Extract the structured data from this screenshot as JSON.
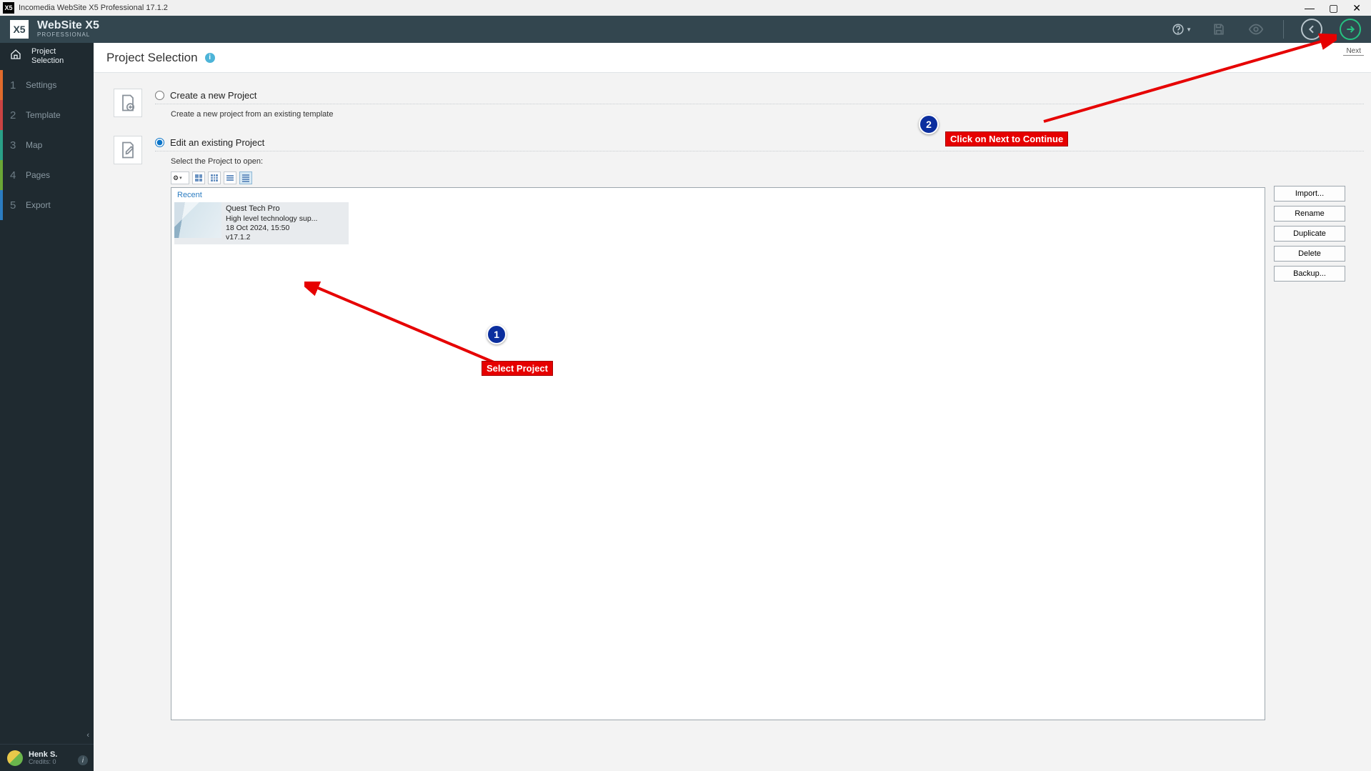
{
  "window": {
    "title": "Incomedia WebSite X5 Professional 17.1.2"
  },
  "brand": {
    "name": "WebSite X5",
    "edition": "PROFESSIONAL",
    "logo_text": "X5"
  },
  "header_buttons": {
    "next_label": "Next"
  },
  "sidebar": {
    "main": {
      "label": "Project\nSelection"
    },
    "steps": [
      {
        "num": "1",
        "label": "Settings"
      },
      {
        "num": "2",
        "label": "Template"
      },
      {
        "num": "3",
        "label": "Map"
      },
      {
        "num": "4",
        "label": "Pages"
      },
      {
        "num": "5",
        "label": "Export"
      }
    ],
    "user": {
      "name": "Henk S.",
      "credits": "Credits: 0"
    }
  },
  "page": {
    "title": "Project Selection"
  },
  "options": {
    "create": {
      "label": "Create a new Project",
      "sub": "Create a new project from an existing template"
    },
    "edit": {
      "label": "Edit an existing Project",
      "sub": "Select the Project to open:"
    }
  },
  "projects": {
    "group": "Recent",
    "items": [
      {
        "name": "Quest Tech Pro",
        "desc": "High level technology sup...",
        "date": "18 Oct 2024, 15:50",
        "ver": "v17.1.2"
      }
    ]
  },
  "buttons": {
    "import": "Import...",
    "rename": "Rename",
    "duplicate": "Duplicate",
    "delete": "Delete",
    "backup": "Backup..."
  },
  "annotations": {
    "one": {
      "num": "1",
      "text": "Select Project"
    },
    "two": {
      "num": "2",
      "text": "Click on Next to Continue"
    }
  }
}
